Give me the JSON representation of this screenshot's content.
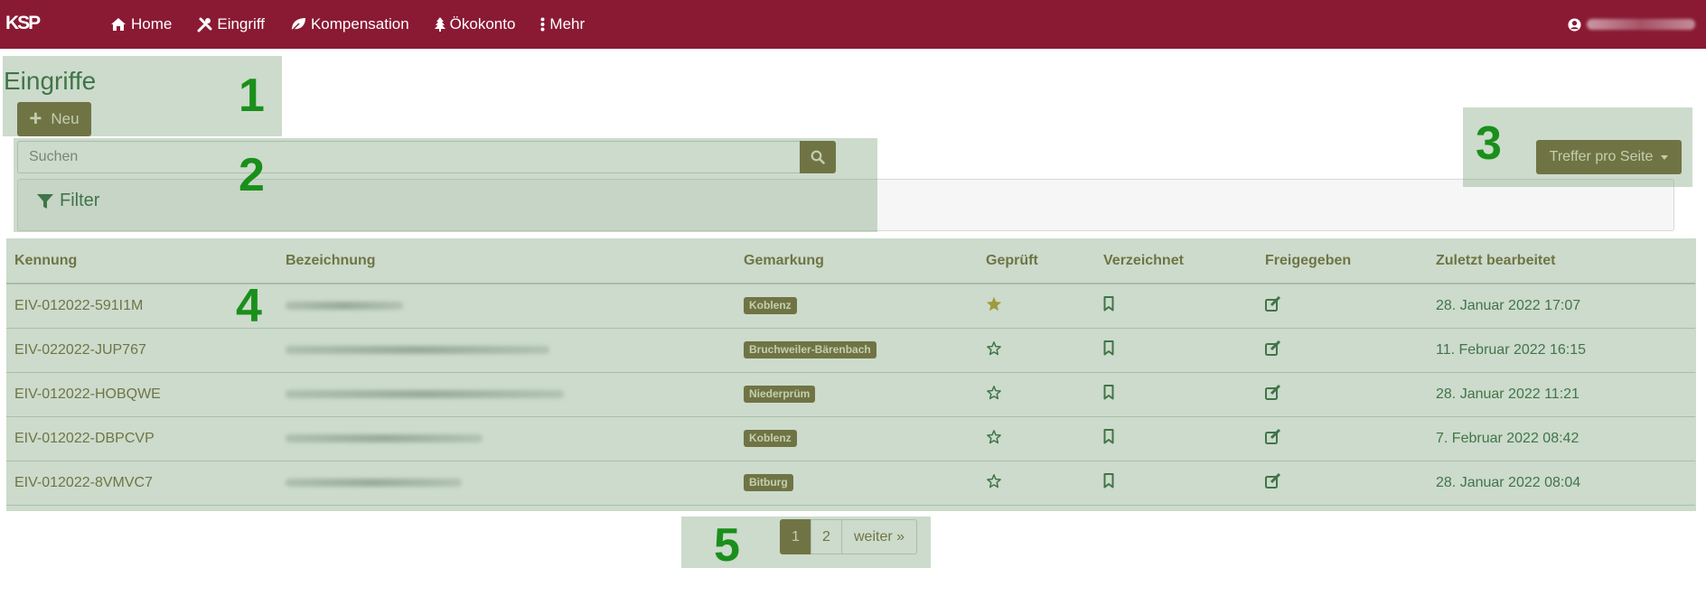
{
  "brand": "KSP",
  "nav": {
    "items": [
      {
        "label": "Home",
        "icon": "home-icon"
      },
      {
        "label": "Eingriff",
        "icon": "tools-icon"
      },
      {
        "label": "Kompensation",
        "icon": "leaf-icon"
      },
      {
        "label": "Ökokonto",
        "icon": "tree-icon"
      },
      {
        "label": "Mehr",
        "icon": "ellipsis-vertical-icon"
      }
    ],
    "user_icon": "user-circle-icon"
  },
  "regions": [
    "1",
    "2",
    "3",
    "4",
    "5"
  ],
  "page": {
    "title": "Eingriffe",
    "new_button": "Neu"
  },
  "search": {
    "placeholder": "Suchen"
  },
  "filter": {
    "label": "Filter"
  },
  "per_page": {
    "label": "Treffer pro Seite"
  },
  "table": {
    "columns": [
      "Kennung",
      "Bezeichnung",
      "Gemarkung",
      "Geprüft",
      "Verzeichnet",
      "Freigegeben",
      "Zuletzt bearbeitet"
    ],
    "rows": [
      {
        "kennung": "EIV-012022-591I1M",
        "gemarkung": "Koblenz",
        "geprueft": true,
        "zuletzt": "28. Januar 2022 17:07"
      },
      {
        "kennung": "EIV-022022-JUP767",
        "gemarkung": "Bruchweiler-Bärenbach",
        "geprueft": false,
        "zuletzt": "11. Februar 2022 16:15"
      },
      {
        "kennung": "EIV-012022-HOBQWE",
        "gemarkung": "Niederprüm",
        "geprueft": false,
        "zuletzt": "28. Januar 2022 11:21"
      },
      {
        "kennung": "EIV-012022-DBPCVP",
        "gemarkung": "Koblenz",
        "geprueft": false,
        "zuletzt": "7. Februar 2022 08:42"
      },
      {
        "kennung": "EIV-012022-8VMVC7",
        "gemarkung": "Bitburg",
        "geprueft": false,
        "zuletzt": "28. Januar 2022 08:04"
      }
    ]
  },
  "pagination": {
    "pages": [
      "1",
      "2"
    ],
    "next": "weiter »",
    "active": "1"
  },
  "colors": {
    "navbar": "#8a1a34",
    "accent": "#6b5a24",
    "title_green": "#1f5a2a",
    "star_filled": "#b59a1e",
    "region_overlay": "#7aa07a",
    "region_number": "#1a8f1a"
  }
}
